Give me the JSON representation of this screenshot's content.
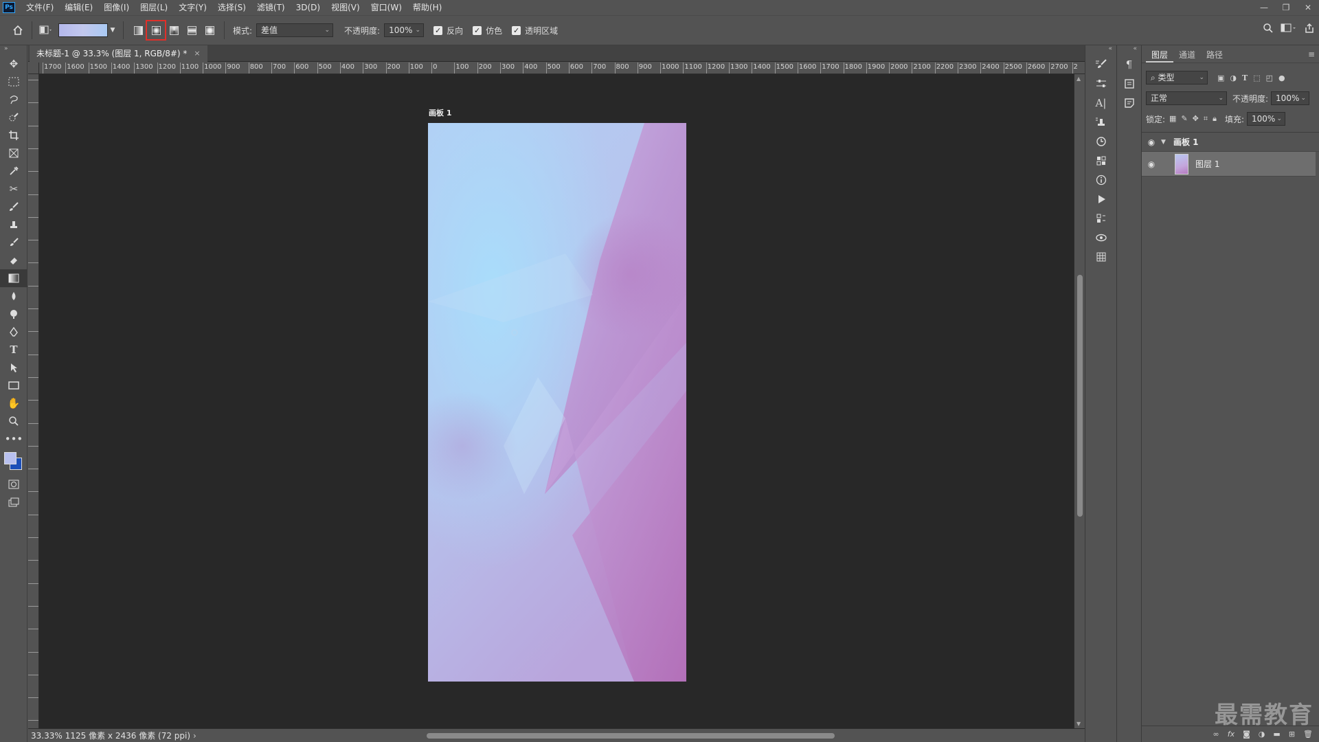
{
  "app": {
    "logo": "Ps"
  },
  "menu": [
    "文件(F)",
    "编辑(E)",
    "图像(I)",
    "图层(L)",
    "文字(Y)",
    "选择(S)",
    "滤镜(T)",
    "3D(D)",
    "视图(V)",
    "窗口(W)",
    "帮助(H)"
  ],
  "window_controls": {
    "minimize": "—",
    "restore": "❐",
    "close": "✕"
  },
  "options": {
    "mode_label": "模式:",
    "mode_value": "差值",
    "opacity_label": "不透明度:",
    "opacity_value": "100%",
    "reverse_label": "反向",
    "dither_label": "仿色",
    "transparency_label": "透明区域",
    "active_gradient_type": "radial",
    "highlight_color": "#e0302a"
  },
  "document": {
    "tab_title": "未标题-1 @ 33.3% (图层 1, RGB/8#) *",
    "tab_close": "×",
    "artboard_label": "画板 1",
    "zoom": "33.33%",
    "info": "1125 像素 x 2436 像素 (72 ppi)",
    "info_arrow": "›"
  },
  "ruler_top": [
    "1700",
    "1600",
    "1500",
    "1400",
    "1300",
    "1200",
    "1100",
    "1000",
    "900",
    "800",
    "700",
    "600",
    "500",
    "400",
    "300",
    "200",
    "100",
    "0",
    "100",
    "200",
    "300",
    "400",
    "500",
    "600",
    "700",
    "800",
    "900",
    "1000",
    "1100",
    "1200",
    "1300",
    "1400",
    "1500",
    "1600",
    "1700",
    "1800",
    "1900",
    "2000",
    "2100",
    "2200",
    "2300",
    "2400",
    "2500",
    "2600",
    "2700",
    "2"
  ],
  "layers_panel": {
    "tabs": [
      "图层",
      "通道",
      "路径"
    ],
    "active_tab": 0,
    "filter_label": "类型",
    "blend_mode": "正常",
    "opacity_label": "不透明度:",
    "opacity_value": "100%",
    "lock_label": "锁定:",
    "fill_label": "填充:",
    "fill_value": "100%",
    "artboard_name": "画板 1",
    "layer_name": "图层 1"
  },
  "watermark": "最需教育",
  "colors": {
    "foreground": "#b8c0ef",
    "background": "#1c4fb8",
    "canvas_bg": "#282828",
    "panel_bg": "#535353"
  }
}
